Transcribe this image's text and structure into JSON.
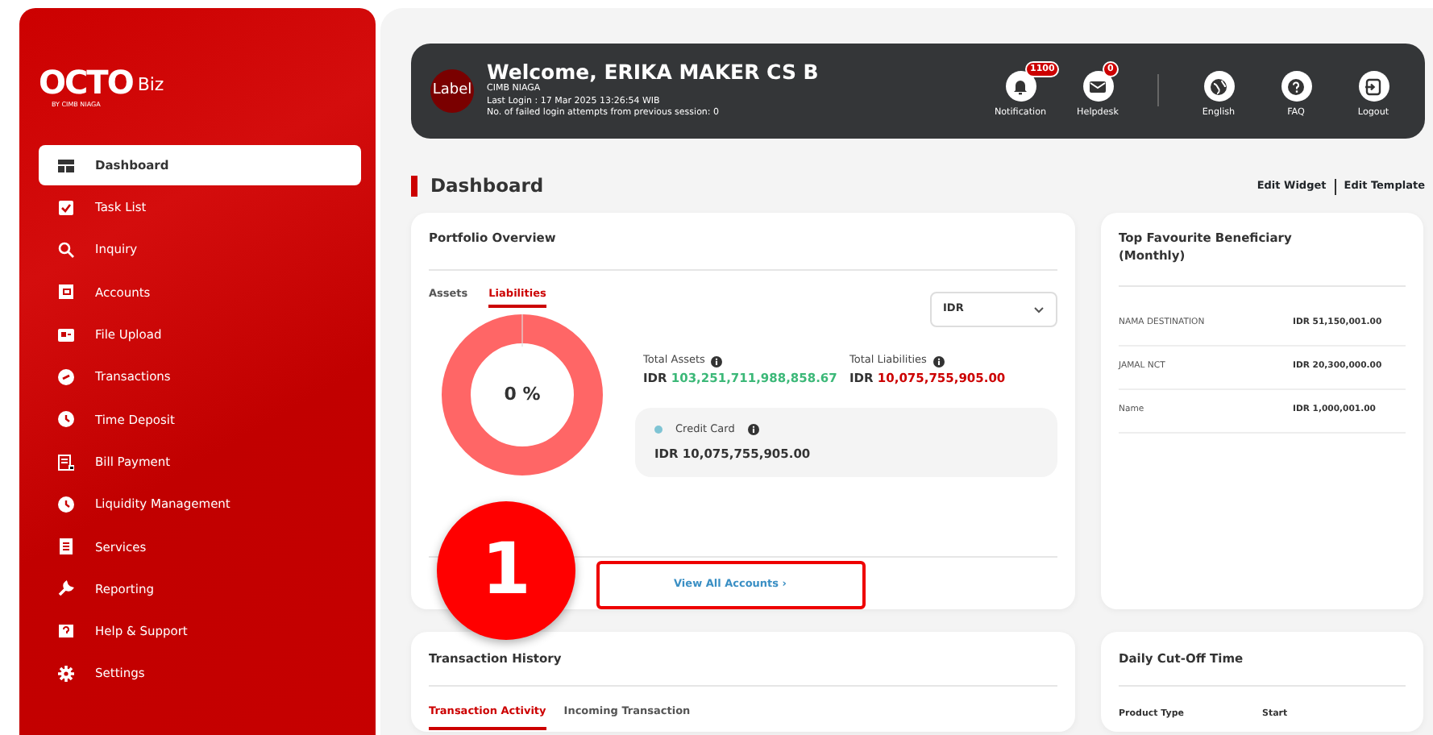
{
  "sidebar": {
    "logo": {
      "word": "OCTO",
      "suffix": "Biz",
      "byline": "BY CIMB NIAGA"
    },
    "items": [
      {
        "label": "Dashboard",
        "selected": true
      },
      {
        "label": "Task List",
        "selected": false
      },
      {
        "label": "Inquiry",
        "selected": false
      },
      {
        "label": "Accounts",
        "selected": false
      },
      {
        "label": "File Upload",
        "selected": false
      },
      {
        "label": "Transactions",
        "selected": false
      },
      {
        "label": "Time Deposit",
        "selected": false
      },
      {
        "label": "Bill Payment",
        "selected": false
      },
      {
        "label": "Liquidity Management",
        "selected": false
      },
      {
        "label": "Services",
        "selected": false
      },
      {
        "label": "Reporting",
        "selected": false
      },
      {
        "label": "Help & Support",
        "selected": false
      },
      {
        "label": "Settings",
        "selected": false
      }
    ]
  },
  "header": {
    "avatar": "Label",
    "welcome": "Welcome, ERIKA MAKER CS B",
    "company": "CIMB NIAGA",
    "last_login": "Last Login : 17 Mar 2025 13:26:54 WIB",
    "failed_attempts": "No. of failed login attempts from previous session: 0",
    "actions": [
      {
        "label": "Notification",
        "badge": "1100"
      },
      {
        "label": "Helpdesk",
        "badge": "0"
      },
      {
        "label": "English"
      },
      {
        "label": "FAQ"
      },
      {
        "label": "Logout"
      }
    ]
  },
  "page_title": "Dashboard",
  "page_links": [
    "Edit Widget",
    "Edit Template"
  ],
  "portfolio": {
    "title": "Portfolio Overview",
    "tabs": [
      {
        "label": "Assets",
        "selected": false
      },
      {
        "label": "Liabilities",
        "selected": true
      }
    ],
    "currency": "IDR",
    "donut_label": "0 %",
    "total_assets": {
      "label": "Total Assets",
      "currency": "IDR",
      "amount": "103,251,711,988,858.67"
    },
    "total_liabilities": {
      "label": "Total Liabilities",
      "currency": "IDR",
      "amount": "10,075,755,905.00"
    },
    "breakdown": [
      {
        "label": "Credit Card",
        "color": "#7fc4d4",
        "amount": "IDR 10,075,755,905.00"
      }
    ],
    "view_all": "View All Accounts ›",
    "highlighted": true
  },
  "beneficiary": {
    "title": "Top Favourite Beneficiary (Monthly)",
    "rows": [
      {
        "name": "NAMA DESTINATION",
        "amount": "IDR 51,150,001.00"
      },
      {
        "name": "JAMAL NCT",
        "amount": "IDR 20,300,000.00"
      },
      {
        "name": "Name",
        "amount": "IDR 1,000,001.00"
      }
    ]
  },
  "history": {
    "title": "Transaction History",
    "tabs": [
      {
        "label": "Transaction Activity",
        "selected": true
      },
      {
        "label": "Incoming Transaction",
        "selected": false
      }
    ]
  },
  "cutoff": {
    "title": "Daily Cut-Off Time",
    "columns": [
      "Product Type",
      "Start"
    ]
  },
  "callout": "1"
}
